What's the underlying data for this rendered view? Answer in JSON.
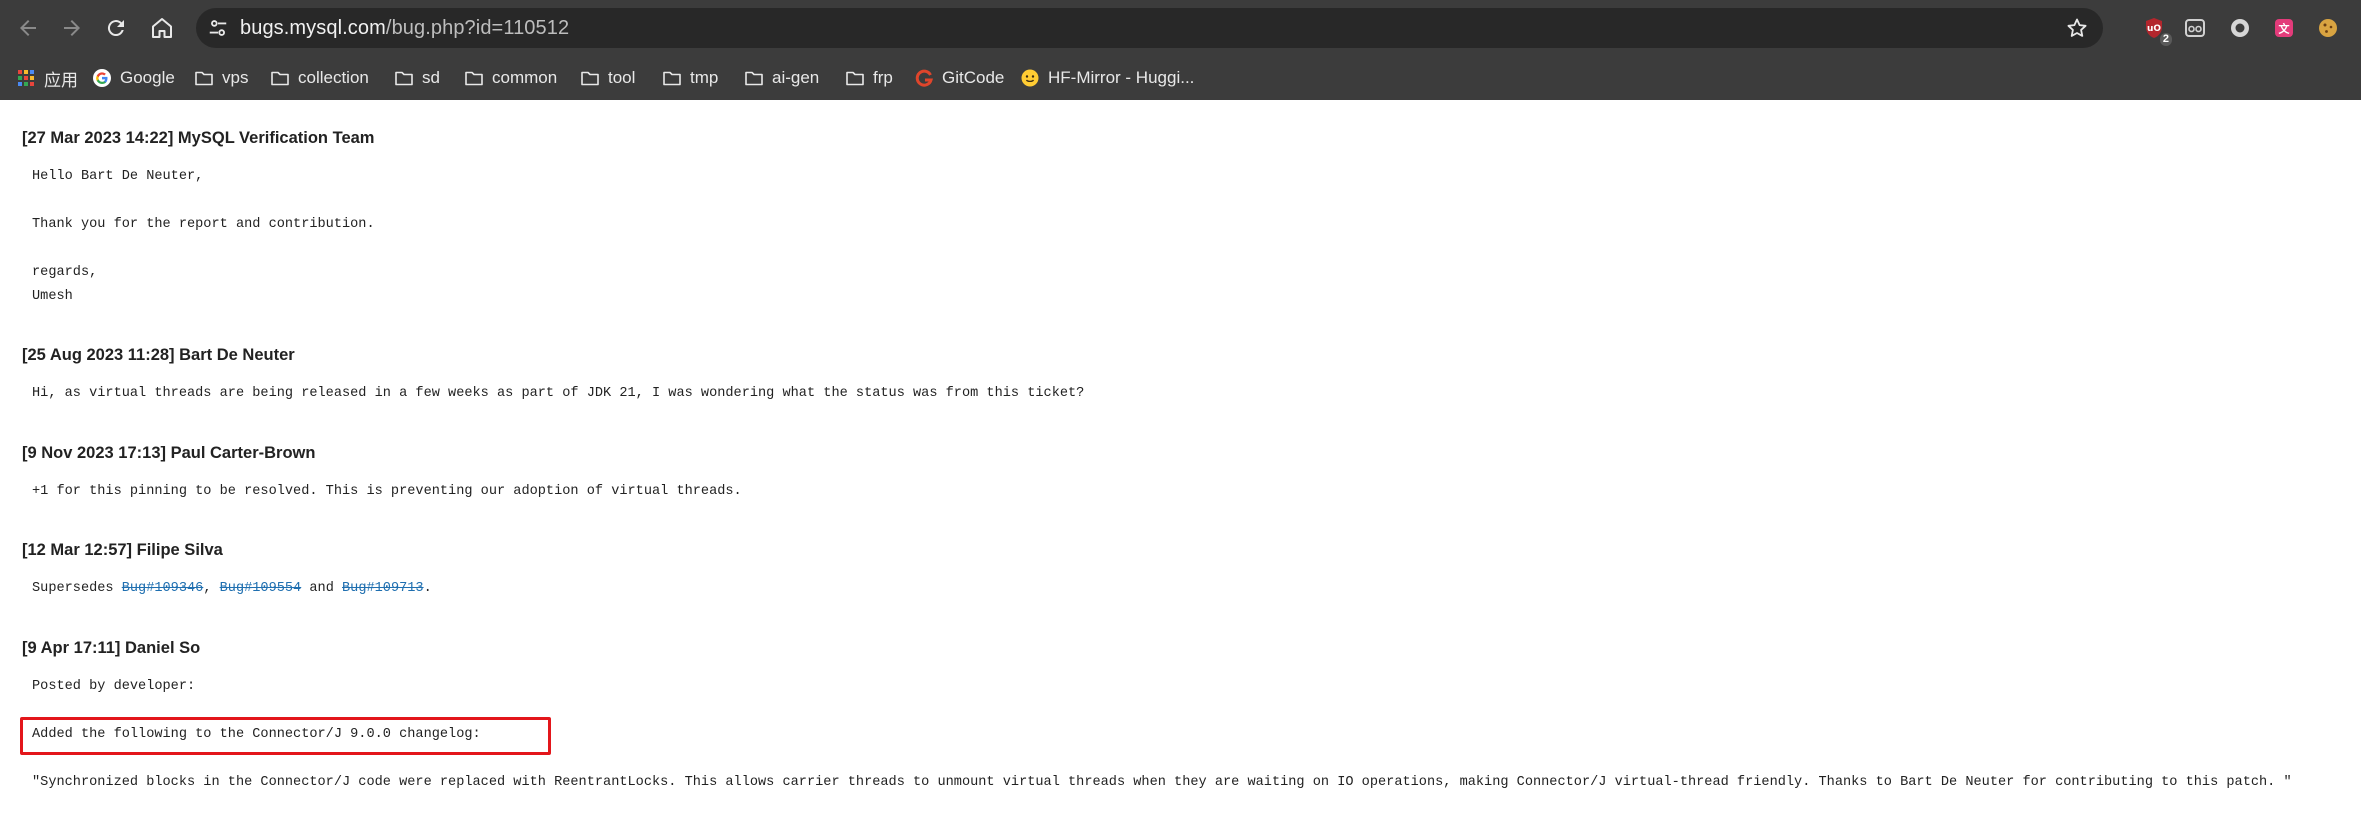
{
  "browser": {
    "url_host": "bugs.mysql.com",
    "url_path": "/bug.php?id=110512",
    "extensions": [
      {
        "name": "ublock-icon",
        "badge": "2",
        "color": "#c0392b"
      },
      {
        "name": "reader-icon",
        "color": "#cfcfcf"
      },
      {
        "name": "record-icon",
        "color": "#e0e0e0"
      },
      {
        "name": "translate-icon",
        "color": "#e33b7a"
      },
      {
        "name": "cookie-icon",
        "color": "#d9a441"
      }
    ],
    "bookmarks": [
      {
        "label": "应用",
        "icon": "apps-grid-icon"
      },
      {
        "label": "Google",
        "icon": "google-icon"
      },
      {
        "label": "vps",
        "icon": "folder-icon"
      },
      {
        "label": "collection",
        "icon": "folder-icon"
      },
      {
        "label": "sd",
        "icon": "folder-icon"
      },
      {
        "label": "common",
        "icon": "folder-icon"
      },
      {
        "label": "tool",
        "icon": "folder-icon"
      },
      {
        "label": "tmp",
        "icon": "folder-icon"
      },
      {
        "label": "ai-gen",
        "icon": "folder-icon"
      },
      {
        "label": "frp",
        "icon": "folder-icon"
      },
      {
        "label": "GitCode",
        "icon": "gitcode-icon"
      },
      {
        "label": "HF-Mirror - Huggi...",
        "icon": "hf-mirror-icon"
      }
    ]
  },
  "comments": [
    {
      "header": "[27 Mar 2023 14:22] MySQL Verification Team",
      "lines": [
        "Hello Bart De Neuter,",
        "Thank you for the report and contribution.",
        "regards,",
        "Umesh"
      ]
    },
    {
      "header": "[25 Aug 2023 11:28] Bart De Neuter",
      "lines": [
        "Hi, as virtual threads are being released in a few weeks as part of JDK 21, I was wondering what the status was from this ticket?"
      ]
    },
    {
      "header": "[9 Nov 2023 17:13] Paul Carter-Brown",
      "lines": [
        "+1 for this pinning to be resolved. This is preventing our adoption of virtual threads."
      ]
    },
    {
      "header": "[12 Mar 12:57] Filipe Silva",
      "supersedes": {
        "prefix": "Supersedes ",
        "bug1": "Bug#109346",
        "sep1": ", ",
        "bug2": "Bug#109554",
        "sep2": " and ",
        "bug3": "Bug#109713",
        "suffix": "."
      }
    },
    {
      "header": "[9 Apr 17:11] Daniel So",
      "lines": [
        "Posted by developer:",
        "Added the following to the Connector/J 9.0.0 changelog:",
        "\"Synchronized blocks in the Connector/J code were replaced with ReentrantLocks. This allows carrier threads to unmount virtual threads when they are waiting on IO operations, making Connector/J virtual-thread friendly. Thanks to Bart De Neuter for contributing to this patch. \""
      ]
    }
  ],
  "colors": {
    "chrome": "#3c3c3c",
    "omnibox": "#282828",
    "link": "#1f6fb0",
    "highlight": "#e3161b"
  }
}
